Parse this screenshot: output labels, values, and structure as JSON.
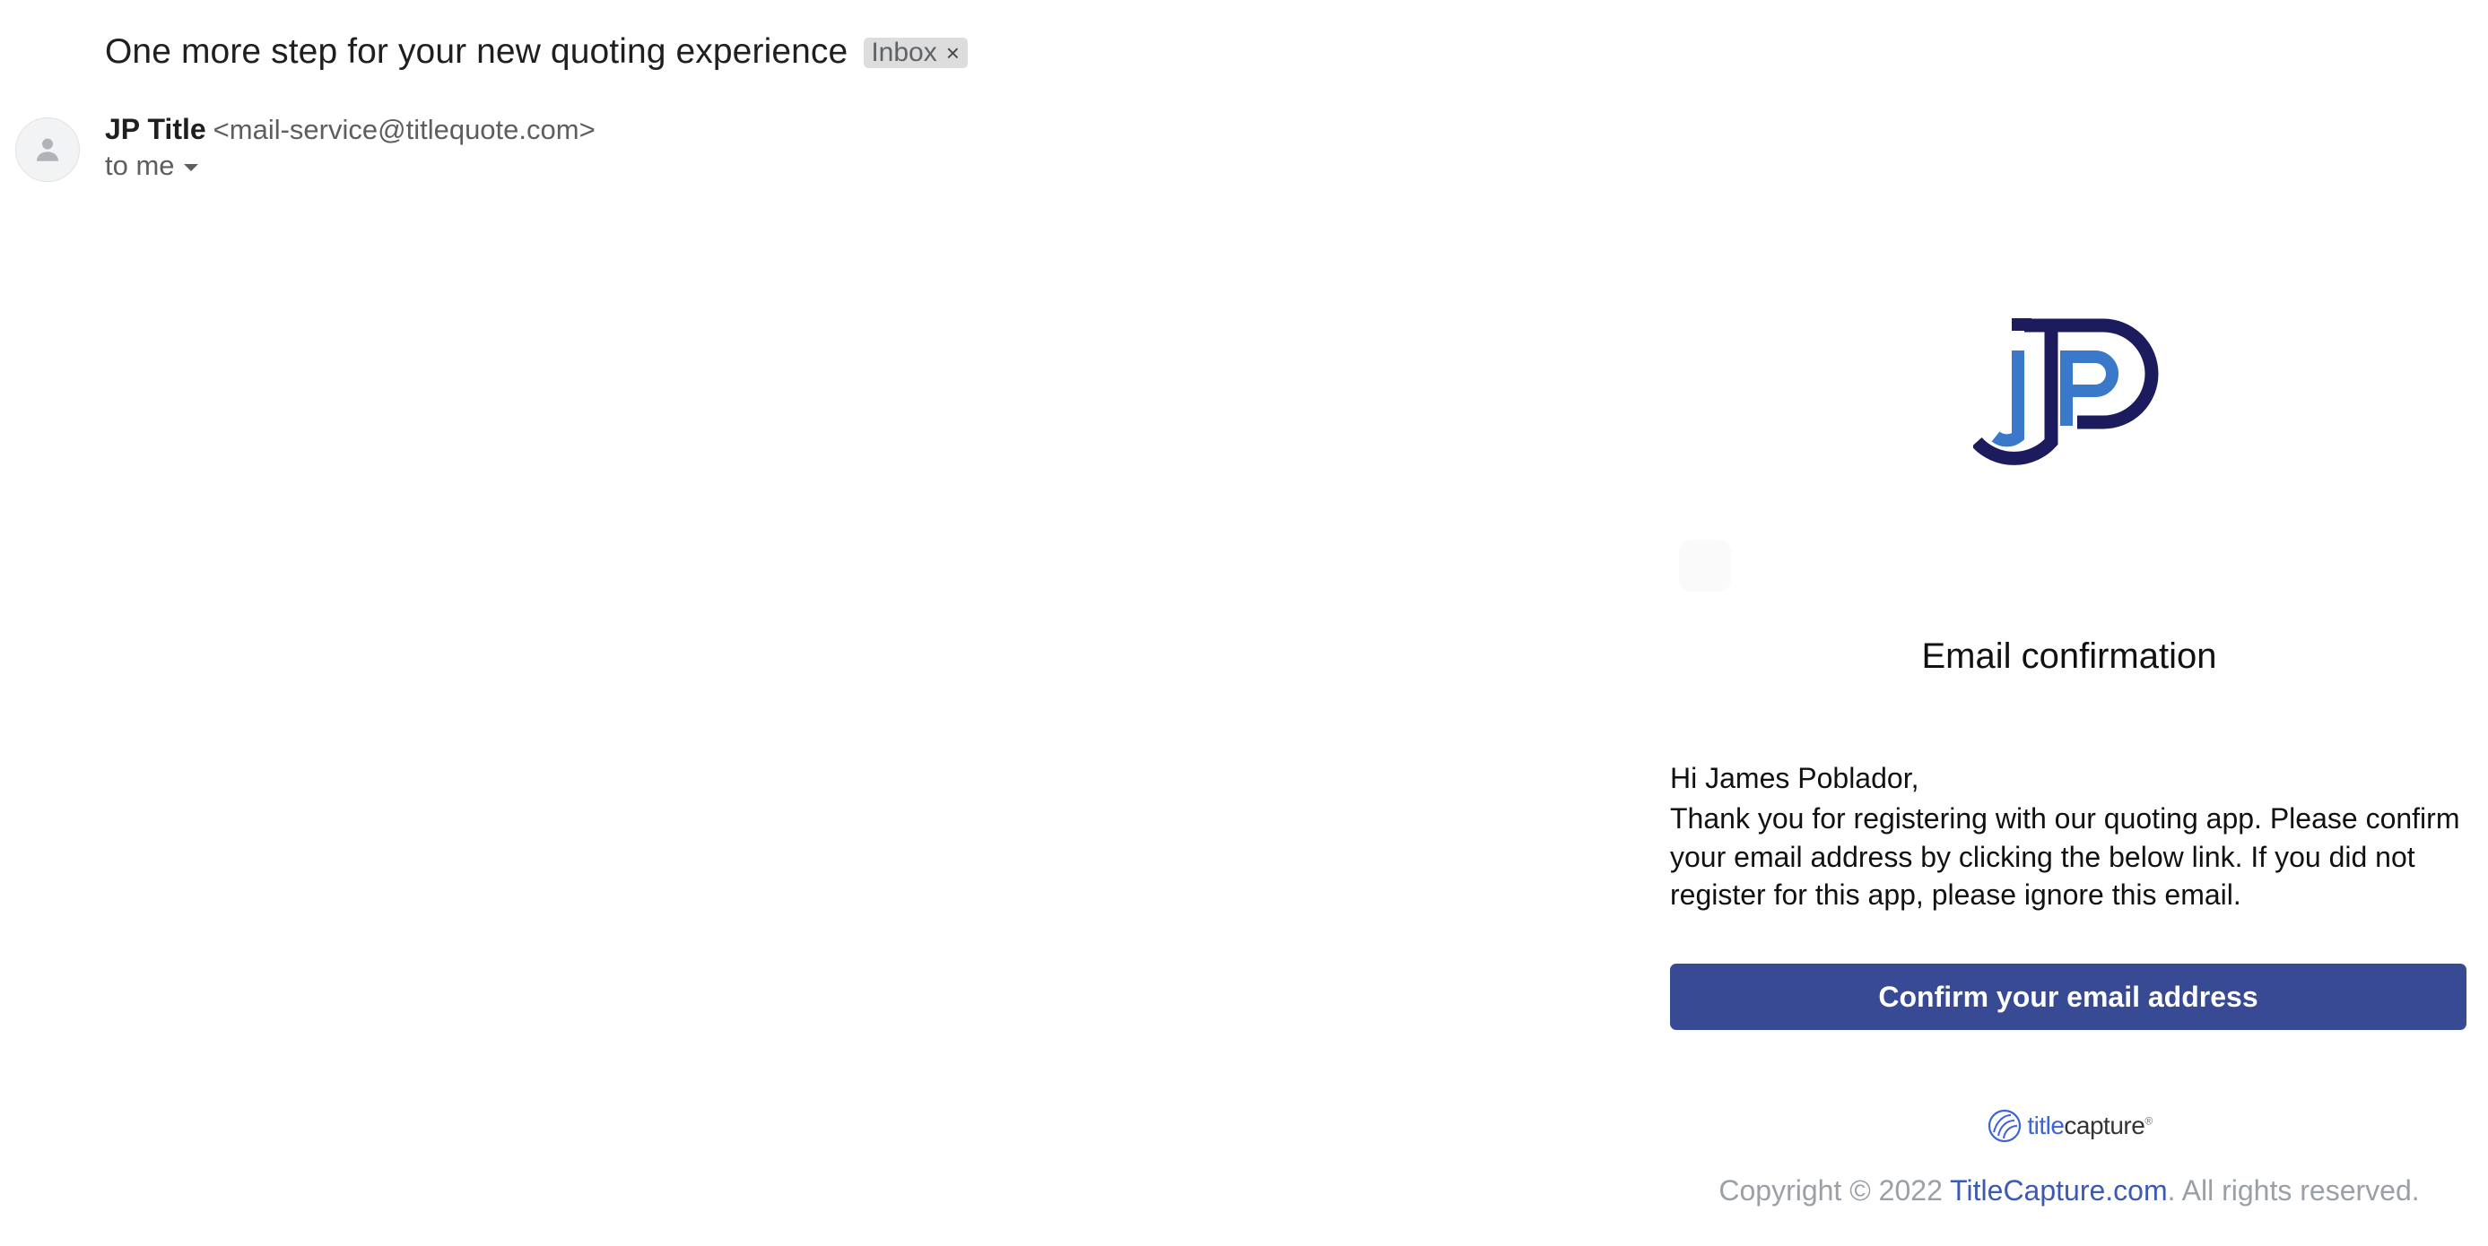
{
  "email": {
    "subject": "One more step for your new quoting experience",
    "label": "Inbox",
    "label_close": "×",
    "sender_name": "JP Title",
    "sender_email": "<mail-service@titlequote.com>",
    "recipient": "to me"
  },
  "body": {
    "logo_text": "JP",
    "heading": "Email confirmation",
    "greeting": "Hi James Poblador,",
    "message": "Thank you for registering with our quoting app. Please confirm your email address by clicking the below link. If you did not register for this app, please ignore this email.",
    "button_label": "Confirm your email address",
    "footer_brand_title": "title",
    "footer_brand_capture": "capture",
    "footer_brand_reg": "®",
    "copyright_prefix": "Copyright © 2022 ",
    "copyright_link": "TitleCapture.com",
    "copyright_suffix": ". All rights reserved."
  },
  "colors": {
    "button": "#384a93",
    "logo_dark": "#1c1b5e",
    "logo_light": "#3a78c9",
    "link": "#3c5ab4"
  },
  "icons": {
    "avatar": "person-icon",
    "recipient_toggle": "caret-down-icon",
    "brand": "jp-title-logo",
    "footer_brand": "titlecapture-logo"
  }
}
